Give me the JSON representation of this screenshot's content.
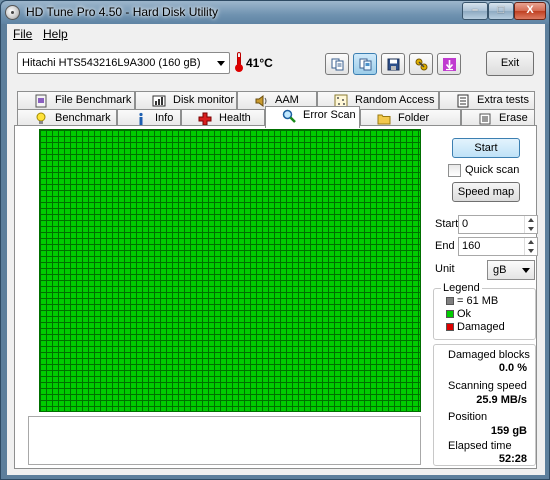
{
  "window": {
    "title": "HD Tune Pro 4.50 - Hard Disk Utility"
  },
  "titlebar_buttons": {
    "minimize": "–",
    "maximize": "□",
    "close": "X"
  },
  "menu": {
    "items": [
      "File",
      "Help"
    ]
  },
  "toolbar": {
    "drive": "Hitachi HTS543216L9A300 (160 gB)",
    "temperature": "41°C",
    "buttons": [
      "copy-info-icon",
      "copy-screenshot-icon",
      "save-icon",
      "options-icon",
      "exit-arrow-icon"
    ],
    "exit_label": "Exit"
  },
  "tabs": {
    "top_row": [
      {
        "label": "File Benchmark",
        "icon": "file-benchmark-icon"
      },
      {
        "label": "Disk monitor",
        "icon": "disk-monitor-icon"
      },
      {
        "label": "AAM",
        "icon": "speaker-icon"
      },
      {
        "label": "Random Access",
        "icon": "random-access-icon"
      },
      {
        "label": "Extra tests",
        "icon": "extra-tests-icon"
      }
    ],
    "bottom_row": [
      {
        "label": "Benchmark",
        "icon": "lightbulb-icon"
      },
      {
        "label": "Info",
        "icon": "info-icon"
      },
      {
        "label": "Health",
        "icon": "health-cross-icon"
      },
      {
        "label": "Error Scan",
        "icon": "magnifier-icon",
        "selected": true
      },
      {
        "label": "Folder Usage",
        "icon": "folder-icon"
      },
      {
        "label": "Erase",
        "icon": "erase-icon"
      }
    ]
  },
  "controls": {
    "start_label": "Start",
    "quick_scan_label": "Quick scan",
    "quick_scan_checked": false,
    "speed_map_label": "Speed map",
    "start_field_label": "Start",
    "start_value": "0",
    "end_field_label": "End",
    "end_value": "160",
    "unit_label": "Unit",
    "unit_value": "gB"
  },
  "legend": {
    "title": "Legend",
    "items": [
      {
        "label": "= 61 MB",
        "color": "#808080"
      },
      {
        "label": "Ok",
        "color": "#00cc00"
      },
      {
        "label": "Damaged",
        "color": "#dd0000"
      }
    ]
  },
  "stats": {
    "damaged_blocks_label": "Damaged blocks",
    "damaged_blocks_value": "0.0 %",
    "scanning_speed_label": "Scanning speed",
    "scanning_speed_value": "25.9 MB/s",
    "position_label": "Position",
    "position_value": "159 gB",
    "elapsed_label": "Elapsed time",
    "elapsed_value": "52:28"
  },
  "scan_grid": {
    "status": "all blocks ok",
    "ok_color": "#00cc00"
  }
}
